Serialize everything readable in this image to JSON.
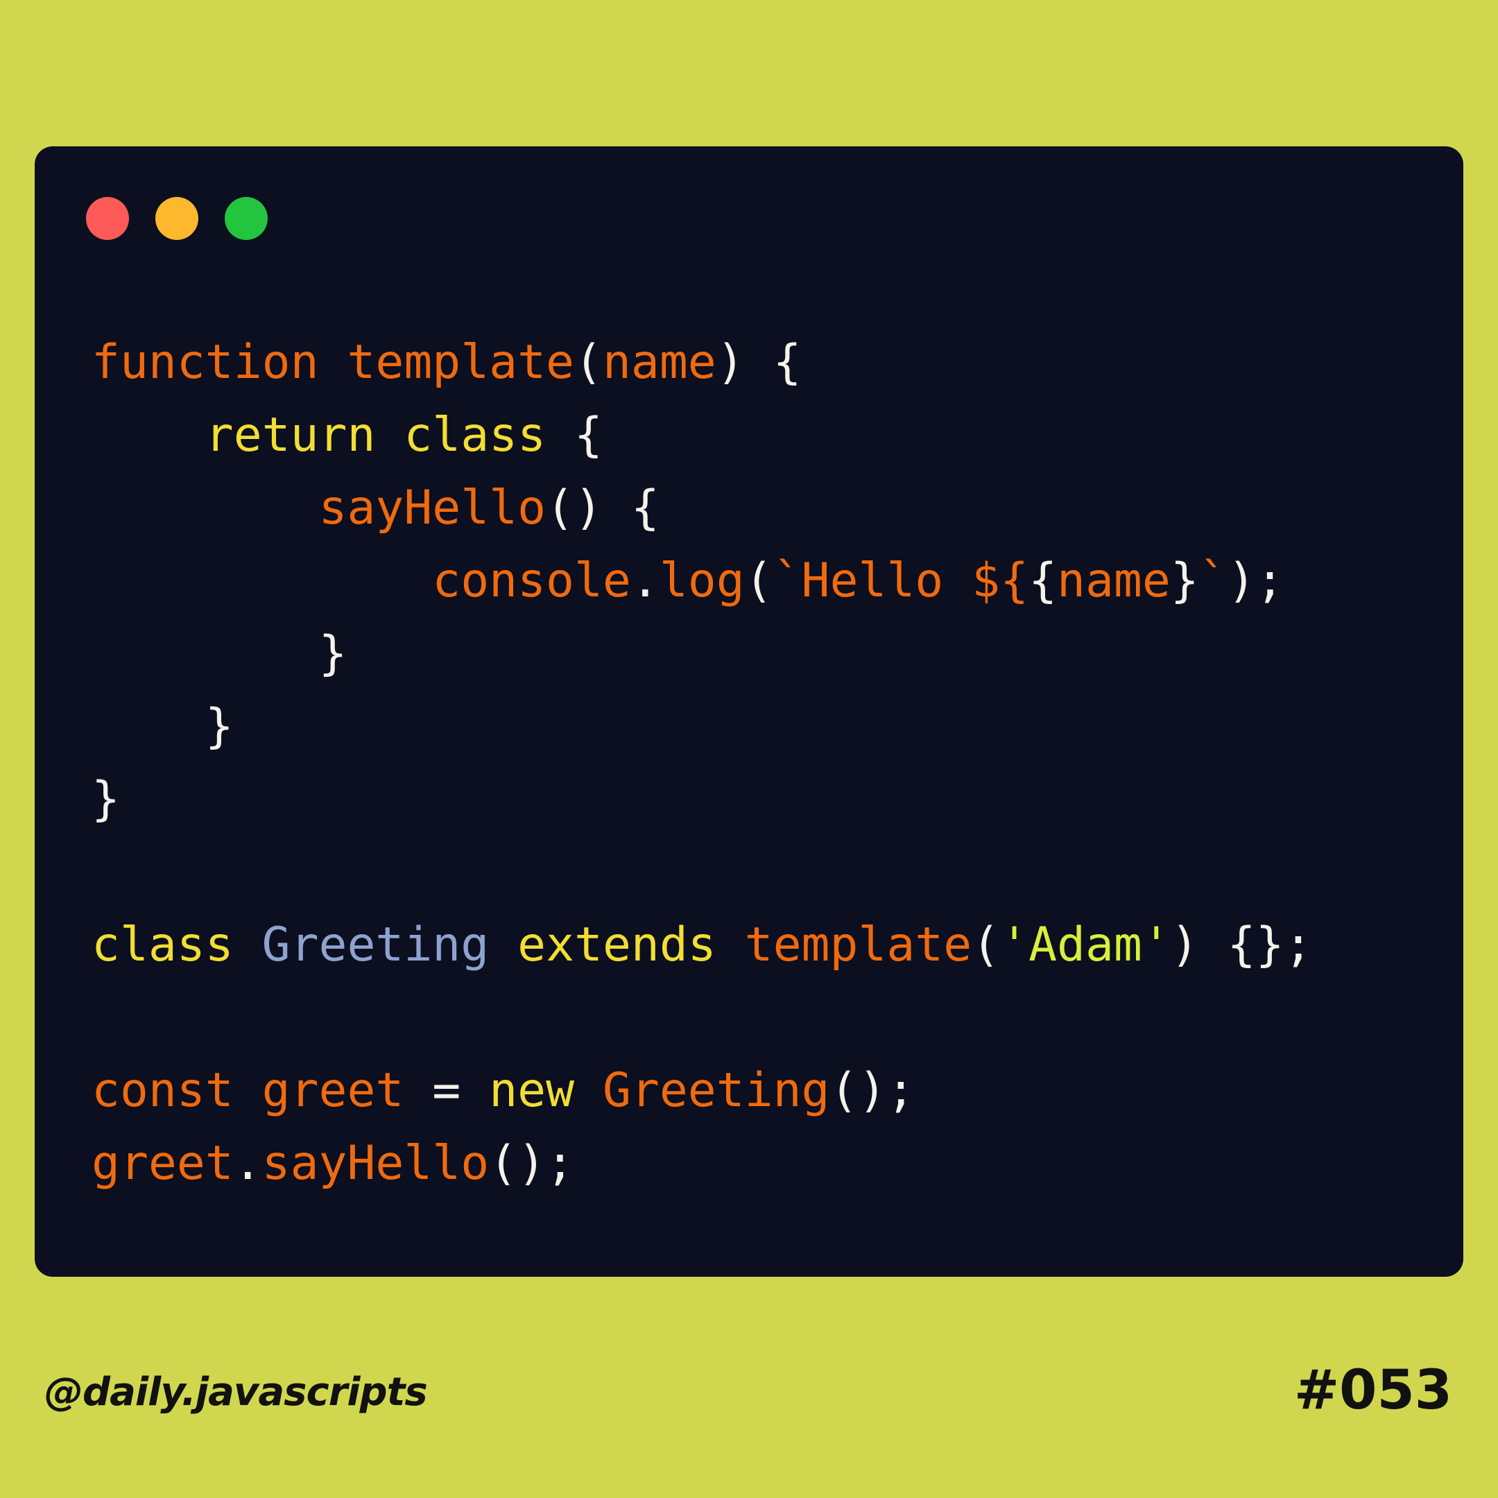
{
  "colors": {
    "background": "#d0d74f",
    "window": "#0c0f1f",
    "close": "#fe5b58",
    "minimize": "#fdb82d",
    "maximize": "#24c53e"
  },
  "window_controls": [
    "close-icon",
    "minimize-icon",
    "maximize-icon"
  ],
  "code": {
    "lines": [
      [
        {
          "t": "function",
          "c": "kw"
        },
        {
          "t": " ",
          "c": "punc"
        },
        {
          "t": "template",
          "c": "fn"
        },
        {
          "t": "(",
          "c": "punc"
        },
        {
          "t": "name",
          "c": "fn"
        },
        {
          "t": ") {",
          "c": "punc"
        }
      ],
      [
        {
          "t": "    ",
          "c": "punc"
        },
        {
          "t": "return",
          "c": "kw2"
        },
        {
          "t": " ",
          "c": "punc"
        },
        {
          "t": "class",
          "c": "kw2"
        },
        {
          "t": " {",
          "c": "punc"
        }
      ],
      [
        {
          "t": "        ",
          "c": "punc"
        },
        {
          "t": "sayHello",
          "c": "fn"
        },
        {
          "t": "() {",
          "c": "punc"
        }
      ],
      [
        {
          "t": "            ",
          "c": "punc"
        },
        {
          "t": "console",
          "c": "fn"
        },
        {
          "t": ".",
          "c": "punc"
        },
        {
          "t": "log",
          "c": "fn"
        },
        {
          "t": "(",
          "c": "punc"
        },
        {
          "t": "`Hello ${",
          "c": "tpl"
        },
        {
          "t": "{",
          "c": "punc"
        },
        {
          "t": "name",
          "c": "fn"
        },
        {
          "t": "}",
          "c": "punc"
        },
        {
          "t": "`",
          "c": "tpl"
        },
        {
          "t": ");",
          "c": "punc"
        }
      ],
      [
        {
          "t": "        }",
          "c": "punc"
        }
      ],
      [
        {
          "t": "    }",
          "c": "punc"
        }
      ],
      [
        {
          "t": "}",
          "c": "punc"
        }
      ],
      [],
      [
        {
          "t": "class",
          "c": "kw2"
        },
        {
          "t": " ",
          "c": "punc"
        },
        {
          "t": "Greeting",
          "c": "cls"
        },
        {
          "t": " ",
          "c": "punc"
        },
        {
          "t": "extends",
          "c": "kw2"
        },
        {
          "t": " ",
          "c": "punc"
        },
        {
          "t": "template",
          "c": "fn"
        },
        {
          "t": "(",
          "c": "punc"
        },
        {
          "t": "'Adam'",
          "c": "str"
        },
        {
          "t": ") {};",
          "c": "punc"
        }
      ],
      [],
      [
        {
          "t": "const",
          "c": "kw"
        },
        {
          "t": " ",
          "c": "punc"
        },
        {
          "t": "greet",
          "c": "fn"
        },
        {
          "t": " = ",
          "c": "punc"
        },
        {
          "t": "new",
          "c": "kw2"
        },
        {
          "t": " ",
          "c": "punc"
        },
        {
          "t": "Greeting",
          "c": "fn"
        },
        {
          "t": "();",
          "c": "punc"
        }
      ],
      [
        {
          "t": "greet",
          "c": "fn"
        },
        {
          "t": ".",
          "c": "punc"
        },
        {
          "t": "sayHello",
          "c": "fn"
        },
        {
          "t": "();",
          "c": "punc"
        }
      ]
    ]
  },
  "footer": {
    "handle": "@daily.javascripts",
    "post_number": "#053"
  }
}
